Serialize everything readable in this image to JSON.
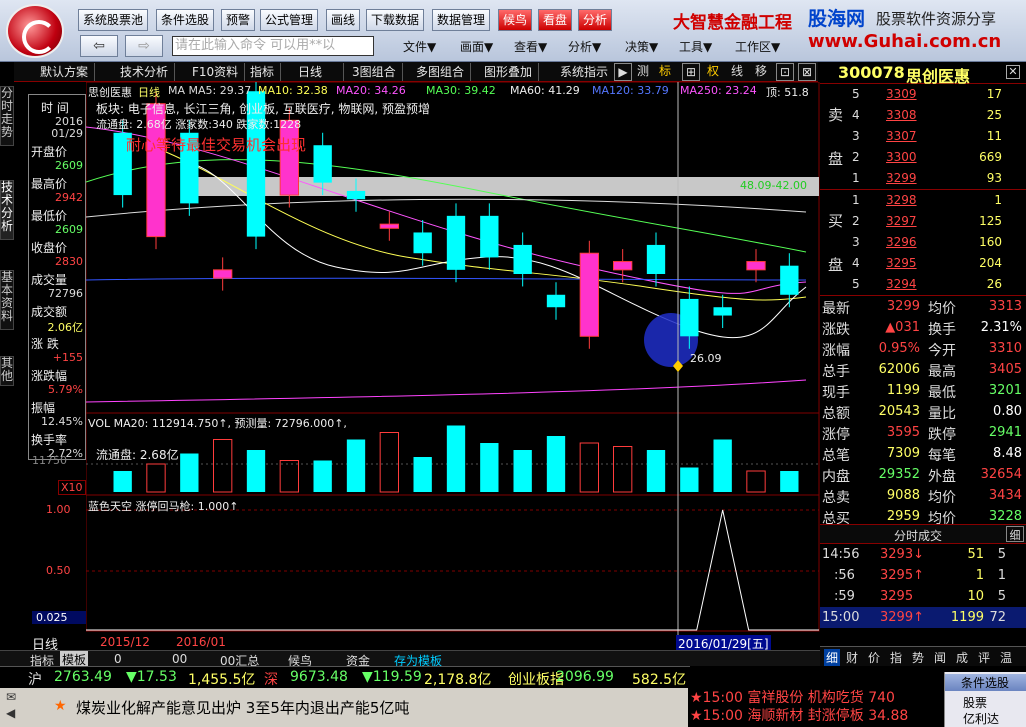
{
  "toolbar": {
    "buttons": [
      "系统股票池",
      "条件选股",
      "预警",
      "公式管理",
      "画线",
      "下载数据",
      "数据管理",
      "候鸟",
      "看盘",
      "分析"
    ],
    "brand": "大智慧金融工程",
    "watermark_1": "股海网",
    "watermark_2": "股票软件资源分享",
    "watermark_3": "www.Guhai.com.cn",
    "back_glyph": "⇦",
    "forward_glyph": "⇨",
    "command_placeholder": "请在此输入命令    可以用**以",
    "menus": [
      "文件▼",
      "画面▼",
      "查看▼",
      "分析▼",
      "决策▼",
      "工具▼",
      "工作区▼"
    ]
  },
  "tabs": {
    "items": [
      "默认方案",
      "技术分析",
      "F10资料",
      "指标",
      "日线",
      "3图组合",
      "多图组合",
      "图形叠加",
      "系统指示"
    ],
    "right_symbols": [
      "▶",
      "测",
      "标",
      "⊞",
      "权",
      "线",
      "移",
      "⊡",
      "⊠"
    ]
  },
  "vertical_tabs": [
    "分时走势",
    "技术分析",
    "基本资料",
    "其他"
  ],
  "info_panel": {
    "rows": [
      {
        "label": "时 间",
        "value": ""
      },
      {
        "label": "",
        "value": "2016"
      },
      {
        "label": "",
        "value": "01/29"
      },
      {
        "label": "开盘价",
        "value": "2609"
      },
      {
        "label": "最高价",
        "value": "2942"
      },
      {
        "label": "最低价",
        "value": "2609"
      },
      {
        "label": "收盘价",
        "value": "2830"
      },
      {
        "label": "成交量",
        "value": "72796"
      },
      {
        "label": "成交额",
        "value": "2.06亿"
      },
      {
        "label": "涨 跌",
        "value": "+155"
      },
      {
        "label": "涨跌幅",
        "value": "5.79%"
      },
      {
        "label": "振幅",
        "value": "12.45%"
      },
      {
        "label": "换手率",
        "value": "2.72%"
      }
    ]
  },
  "chart": {
    "title": "思创医惠",
    "period": "日线",
    "ma_line": [
      {
        "text": "MA  MA5: 29.37",
        "color": "#ffffff"
      },
      {
        "text": "MA10: 32.38",
        "color": "#ffff55"
      },
      {
        "text": "MA20: 34.26",
        "color": "#ff55ff"
      },
      {
        "text": "MA30: 39.42",
        "color": "#55ff55"
      },
      {
        "text": "MA60: 41.29",
        "color": "#ffffff"
      },
      {
        "text": "MA120: 33.79",
        "color": "#5577ff"
      },
      {
        "text": "MA250: 23.24",
        "color": "#ff55ff"
      },
      {
        "text": "顶: 51.8",
        "color": "#ffffff"
      }
    ],
    "sector_text": "板块: 电子信息, 长江三角, 创业板, 互联医疗, 物联网, 预盈预增",
    "float_text": "流通盘: 2.68亿    涨家数:340    跌家数:1228",
    "annotation": "耐心等待最佳交易机会出现",
    "zone_label": "48.09-42.00",
    "low_label": "26.09",
    "vol_header": "VOL  MA20: 112914.750↑, 预测量: 72796.000↑,",
    "vol_float": "流通盘: 2.68亿",
    "vol_unit": "X10",
    "vol_side_label": "11750",
    "ind_header": "蓝色天空  涨停回马枪: 1.000↑",
    "ind_ticks": [
      "1.00",
      "0.50",
      "0.025"
    ],
    "x_labels": [
      "日线",
      "2015/12",
      "2016/01"
    ],
    "cursor_date": "2016/01/29[五]"
  },
  "chart_data": {
    "type": "candlestick",
    "candles": [
      {
        "o": 33.5,
        "c": 32.0
      },
      {
        "o": 31.0,
        "c": 34.2
      },
      {
        "o": 33.5,
        "c": 31.8
      },
      {
        "o": 30.0,
        "c": 30.2
      },
      {
        "o": 34.5,
        "c": 31.0
      },
      {
        "o": 32.0,
        "c": 33.8
      },
      {
        "o": 33.2,
        "c": 32.3
      },
      {
        "o": 32.1,
        "c": 31.9
      },
      {
        "o": 31.2,
        "c": 31.3
      },
      {
        "o": 31.1,
        "c": 30.6
      },
      {
        "o": 31.5,
        "c": 30.2
      },
      {
        "o": 31.5,
        "c": 30.5
      },
      {
        "o": 30.8,
        "c": 30.1
      },
      {
        "o": 29.6,
        "c": 29.3
      },
      {
        "o": 28.6,
        "c": 30.6
      },
      {
        "o": 30.2,
        "c": 30.4
      },
      {
        "o": 30.8,
        "c": 30.1
      },
      {
        "o": 29.5,
        "c": 28.6
      },
      {
        "o": 29.3,
        "c": 29.1
      },
      {
        "o": 30.2,
        "c": 30.4
      },
      {
        "o": 30.3,
        "c": 29.6
      }
    ],
    "volume": [
      60,
      80,
      110,
      150,
      120,
      90,
      90,
      150,
      170,
      100,
      190,
      140,
      120,
      160,
      140,
      130,
      120,
      70,
      150,
      60,
      60
    ],
    "signal_peak_index": 18
  },
  "right_panel": {
    "stock_code": "300078",
    "stock_name": "思创医惠",
    "sell": [
      {
        "level": "5",
        "price": "3309",
        "vol": "17"
      },
      {
        "level": "4",
        "price": "3308",
        "vol": "25"
      },
      {
        "level": "3",
        "price": "3307",
        "vol": "11"
      },
      {
        "level": "2",
        "price": "3300",
        "vol": "669"
      },
      {
        "level": "1",
        "price": "3299",
        "vol": "93"
      }
    ],
    "buy": [
      {
        "level": "1",
        "price": "3298",
        "vol": "1"
      },
      {
        "level": "2",
        "price": "3297",
        "vol": "125"
      },
      {
        "level": "3",
        "price": "3296",
        "vol": "160"
      },
      {
        "level": "4",
        "price": "3295",
        "vol": "204"
      },
      {
        "level": "5",
        "price": "3294",
        "vol": "26"
      }
    ],
    "sell_label": [
      "卖",
      "盘"
    ],
    "buy_label": [
      "买",
      "盘"
    ],
    "stats": [
      {
        "k1": "最新",
        "v1": "3299",
        "c1": "#ff4444",
        "k2": "均价",
        "v2": "3313",
        "c2": "#ff4444"
      },
      {
        "k1": "涨跌",
        "v1": "▲031",
        "c1": "#ff4444",
        "k2": "换手",
        "v2": "2.31%",
        "c2": "#ffffff"
      },
      {
        "k1": "涨幅",
        "v1": "0.95%",
        "c1": "#ff4444",
        "k2": "今开",
        "v2": "3310",
        "c2": "#ff4444"
      },
      {
        "k1": "总手",
        "v1": "62006",
        "c1": "#ffff66",
        "k2": "最高",
        "v2": "3405",
        "c2": "#ff4444"
      },
      {
        "k1": "现手",
        "v1": "1199",
        "c1": "#ffff66",
        "k2": "最低",
        "v2": "3201",
        "c2": "#66ff66"
      },
      {
        "k1": "总额",
        "v1": "20543",
        "c1": "#ffff66",
        "k2": "量比",
        "v2": "0.80",
        "c2": "#ffffff"
      },
      {
        "k1": "涨停",
        "v1": "3595",
        "c1": "#ff4444",
        "k2": "跌停",
        "v2": "2941",
        "c2": "#66ff66"
      },
      {
        "k1": "总笔",
        "v1": "7309",
        "c1": "#ffff66",
        "k2": "每笔",
        "v2": "8.48",
        "c2": "#ffffff"
      },
      {
        "k1": "内盘",
        "v1": "29352",
        "c1": "#66ff66",
        "k2": "外盘",
        "v2": "32654",
        "c2": "#ff4444"
      },
      {
        "k1": "总卖",
        "v1": "9088",
        "c1": "#ffff66",
        "k2": "均价",
        "v2": "3434",
        "c2": "#ff4444"
      },
      {
        "k1": "总买",
        "v1": "2959",
        "c1": "#ffff66",
        "k2": "均价",
        "v2": "3228",
        "c2": "#66ff66"
      }
    ],
    "ticks_title": "分时成交",
    "ticks_btn": "细",
    "ticks": [
      {
        "time": "14:56",
        "price": "3293↓",
        "vol": "51",
        "n": "5"
      },
      {
        "time": ":56",
        "price": "3295↑",
        "vol": "1",
        "n": "1"
      },
      {
        "time": ":59",
        "price": "3295",
        "vol": "10",
        "n": "5"
      },
      {
        "time": "15:00",
        "price": "3299↑",
        "vol": "1199",
        "n": "72"
      }
    ],
    "bottom_tabs": [
      "细",
      "财",
      "价",
      "指",
      "势",
      "闻",
      "成",
      "评",
      "温"
    ]
  },
  "bottom": {
    "left_tabs": [
      "指标",
      "模板",
      "0",
      "00",
      "00汇总",
      "候鸟",
      "资金",
      "存为模板"
    ],
    "index_line": [
      {
        "text": "沪",
        "color": "#ff4444"
      },
      {
        "text": "2763.49",
        "color": "#66ff66"
      },
      {
        "text": "▼17.53",
        "color": "#66ff66"
      },
      {
        "text": "1,455.5亿",
        "color": "#ffff66"
      },
      {
        "text": "深",
        "color": "#ff4444"
      },
      {
        "text": "9673.48",
        "color": "#66ff66"
      },
      {
        "text": "▼119.59",
        "color": "#66ff66"
      },
      {
        "text": "2,178.8亿",
        "color": "#ffff66"
      },
      {
        "text": "创业板指",
        "color": "#ffff66"
      },
      {
        "text": "2096.99",
        "color": "#66ff66"
      },
      {
        "text": "582.5亿",
        "color": "#ffff66"
      }
    ],
    "news": "煤炭业化解产能意见出炉  3至5年内退出产能5亿吨",
    "alert1": "★15:00 富祥股份 机构吃货  740",
    "alert2": "★15:00 海顺新材 封涨停板  34.88",
    "side_label": "条件选股",
    "side_item1": "股票",
    "side_item2": "亿利达"
  },
  "colors": {
    "up": "#ff3c3c",
    "down": "#00ffff",
    "panel_border": "#880000"
  }
}
